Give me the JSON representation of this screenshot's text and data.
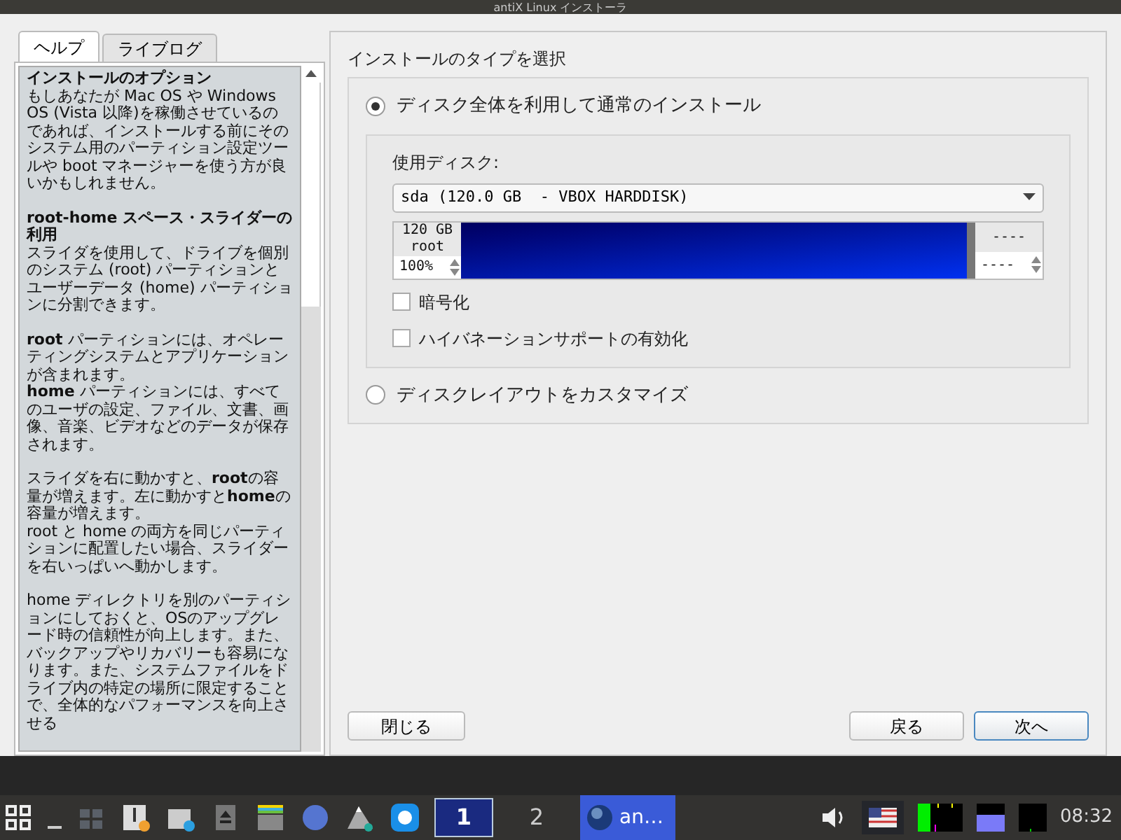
{
  "window": {
    "title": "antiX Linux インストーラ"
  },
  "help_tabs": [
    {
      "label": "ヘルプ",
      "selected": true
    },
    {
      "label": "ライブログ",
      "selected": false
    }
  ],
  "help_paragraphs": [
    {
      "heading": "インストールのオプション",
      "lines": [
        "もしあなたが Mac OS や Windows OS (Vista 以降)を稼働させているのであれば、インストールする前にそのシステム用のパーティション設定ツールや boot マネージャーを使う方が良いかもしれません。"
      ]
    },
    {
      "heading": "root-home スペース・スライダーの利用",
      "lines": [
        "スライダを使用して、ドライブを個別のシステム (root) パーティションとユーザーデータ (home) パーティションに分割できます。"
      ]
    },
    {
      "lines": [
        "**root** パーティションには、オペレーティングシステムとアプリケーションが含まれます。",
        "**home** パーティションには、すべてのユーザの設定、ファイル、文書、画像、音楽、ビデオなどのデータが保存されます。"
      ]
    },
    {
      "lines": [
        "スライダを右に動かすと、**root**の容量が増えます。左に動かすと**home**の容量が増えます。",
        "root と home の両方を同じパーティションに配置したい場合、スライダーを右いっぱいへ動かします。"
      ]
    },
    {
      "lines": [
        "home ディレクトリを別のパーティションにしておくと、OSのアップグレード時の信頼性が向上します。また、バックアップやリカバリーも容易になります。また、システムファイルをドライブ内の特定の場所に限定することで、全体的なパフォーマンスを向上させる"
      ]
    }
  ],
  "install_type": {
    "title": "インストールのタイプを選択",
    "options": [
      {
        "label": "ディスク全体を利用して通常のインストール",
        "selected": true
      },
      {
        "label": "ディスクレイアウトをカスタマイズ",
        "selected": false
      }
    ],
    "disk_label": "使用ディスク:",
    "disk_value": "sda (120.0 GB  - VBOX HARDDISK)",
    "slider": {
      "left_size": "120 GB",
      "left_name": "root",
      "left_percent": "100%",
      "right_size": "----",
      "right_percent": "----",
      "level": 1
    },
    "checkboxes": [
      {
        "label": "暗号化",
        "checked": false
      },
      {
        "label": "ハイバネーションサポートの有効化",
        "checked": false
      }
    ]
  },
  "buttons": {
    "close": "閉じる",
    "back": "戻る",
    "next": "次へ"
  },
  "taskbar": {
    "workspaces": [
      {
        "label": "1",
        "selected": true
      },
      {
        "label": "2",
        "selected": false
      }
    ],
    "task": "an…",
    "clock": "08:32"
  }
}
